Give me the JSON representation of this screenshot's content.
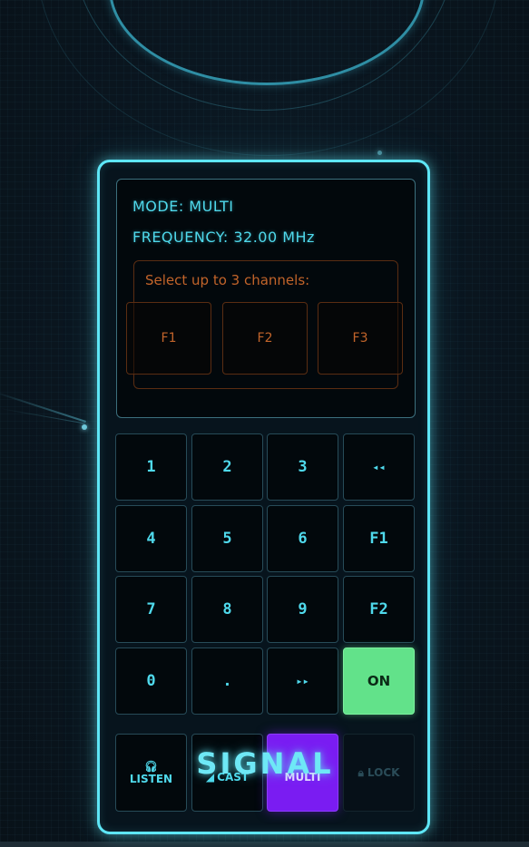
{
  "display": {
    "mode": "MODE: MULTI",
    "frequency": "FREQUENCY: 32.00 MHz",
    "channel_prompt": "Select up to 3 channels:",
    "channels": [
      "F1",
      "F2",
      "F3"
    ]
  },
  "keypad": {
    "rows": [
      [
        "1",
        "2",
        "3",
        "◂◂"
      ],
      [
        "4",
        "5",
        "6",
        "F1"
      ],
      [
        "7",
        "8",
        "9",
        "F2"
      ],
      [
        "0",
        ".",
        "▸▸",
        "ON"
      ]
    ]
  },
  "modes": {
    "listen": "LISTEN",
    "listen_icon": "headphones-icon",
    "cast": "CAST",
    "cast_icon": "broadcast-icon",
    "multi": "MULTI",
    "lock": "LOCK",
    "lock_icon": "lock-icon"
  },
  "brand": "SIGNAL",
  "colors": {
    "accent": "#5ee6f6",
    "channel": "#c2642a",
    "on": "#62e28a",
    "multi": "#7a1cf2"
  }
}
